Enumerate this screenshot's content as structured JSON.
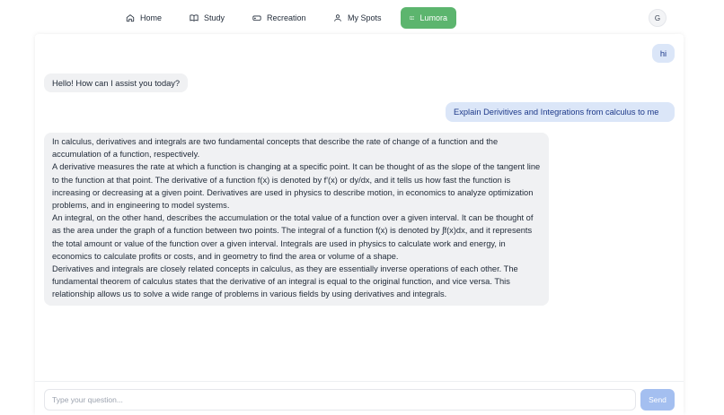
{
  "nav": {
    "items": [
      {
        "label": "Home",
        "icon": "home-icon"
      },
      {
        "label": "Study",
        "icon": "book-icon"
      },
      {
        "label": "Recreation",
        "icon": "gamepad-icon"
      },
      {
        "label": "My Spots",
        "icon": "user-icon"
      },
      {
        "label": "Lumora",
        "icon": "book-open-icon"
      }
    ],
    "active": "Lumora",
    "avatar_initial": "G"
  },
  "messages": [
    {
      "role": "user",
      "text": "hi"
    },
    {
      "role": "assistant",
      "text": "Hello! How can I assist you today?"
    },
    {
      "role": "user",
      "text": "Explain Derivitives and Integrations from calculus to me"
    },
    {
      "role": "assistant",
      "paragraphs": [
        "In calculus, derivatives and integrals are two fundamental concepts that describe the rate of change of a function and the accumulation of a function, respectively.",
        "A derivative measures the rate at which a function is changing at a specific point. It can be thought of as the slope of the tangent line to the function at that point. The derivative of a function f(x) is denoted by f'(x) or dy/dx, and it tells us how fast the function is increasing or decreasing at a given point. Derivatives are used in physics to describe motion, in economics to analyze optimization problems, and in engineering to model systems.",
        "An integral, on the other hand, describes the accumulation or the total value of a function over a given interval. It can be thought of as the area under the graph of a function between two points. The integral of a function f(x) is denoted by ∫f(x)dx, and it represents the total amount or value of the function over a given interval. Integrals are used in physics to calculate work and energy, in economics to calculate profits or costs, and in geometry to find the area or volume of a shape.",
        "Derivatives and integrals are closely related concepts in calculus, as they are essentially inverse operations of each other. The fundamental theorem of calculus states that the derivative of an integral is equal to the original function, and vice versa. This relationship allows us to solve a wide range of problems in various fields by using derivatives and integrals."
      ]
    }
  ],
  "composer": {
    "placeholder": "Type your question...",
    "send_label": "Send"
  },
  "colors": {
    "active_nav": "#5cb56e",
    "user_bubble": "#dbe6f8",
    "assistant_bubble": "#f0f1f3",
    "send_button": "#a4bff0"
  }
}
